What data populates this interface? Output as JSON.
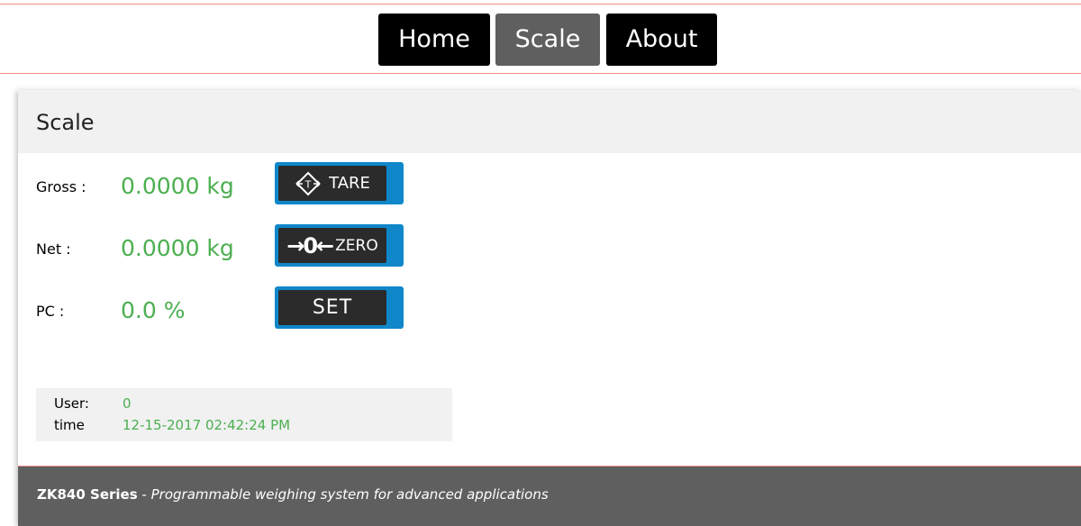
{
  "nav": {
    "items": [
      {
        "label": "Home",
        "active": false
      },
      {
        "label": "Scale",
        "active": true
      },
      {
        "label": "About",
        "active": false
      }
    ]
  },
  "card": {
    "title": "Scale",
    "rows": [
      {
        "label": "Gross :",
        "value": "0.0000 kg",
        "button_label": "TARE",
        "button_icon": "tare-icon"
      },
      {
        "label": "Net :",
        "value": "0.0000 kg",
        "button_label": "ZERO",
        "button_icon": "zero-icon",
        "button_icon_text": "→0←"
      },
      {
        "label": "PC :",
        "value": "0.0 %",
        "button_label": "SET"
      }
    ],
    "info": {
      "user_label": "User:",
      "user_value": "0",
      "time_label": "time",
      "time_value": "12-15-2017 02:42:24 PM"
    }
  },
  "footer": {
    "brand": "ZK840 Series",
    "separator": " - ",
    "description": "Programmable weighing system for advanced applications"
  },
  "colors": {
    "accent_line": "#f08a84",
    "value_green": "#4caf50",
    "button_blue": "#0f87c9",
    "nav_active": "#5f5f5f",
    "nav_default": "#000000",
    "footer_bg": "#5f5f5f"
  }
}
